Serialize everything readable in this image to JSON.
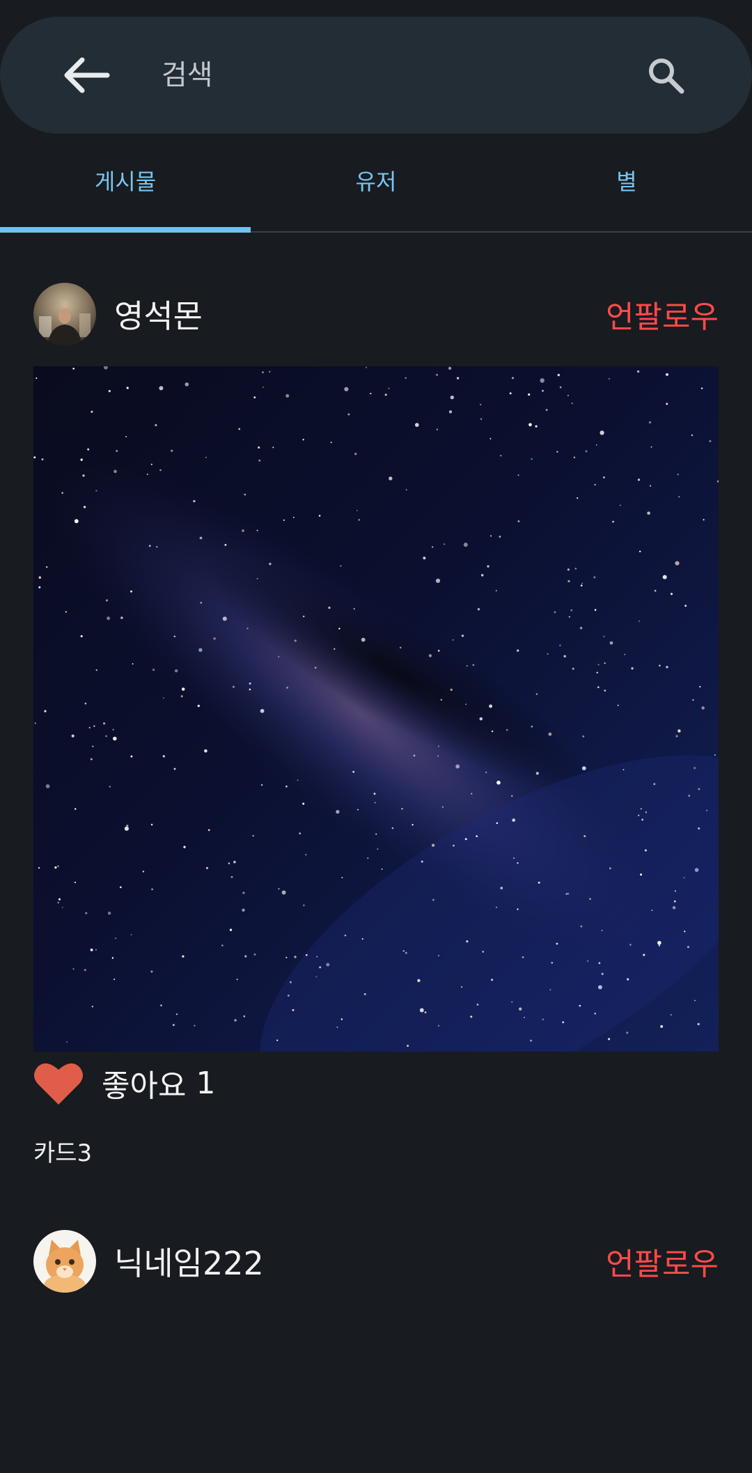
{
  "search": {
    "placeholder": "검색",
    "back_icon": "arrow-left-icon",
    "search_icon": "search-icon"
  },
  "tabs": [
    {
      "label": "게시물",
      "active": true
    },
    {
      "label": "유저",
      "active": false
    },
    {
      "label": "별",
      "active": false
    }
  ],
  "posts": [
    {
      "username": "영석몬",
      "action_label": "언팔로우",
      "avatar_icon": "profile-photo",
      "image": "night-sky-milky-way",
      "like_label": "좋아요",
      "like_count": "1",
      "caption": "카드3"
    },
    {
      "username": "닉네임222",
      "action_label": "언팔로우",
      "avatar_icon": "cat-photo"
    }
  ],
  "colors": {
    "background": "#181b1f",
    "search_bar": "#232d35",
    "tab_text": "#76c6f2",
    "tab_indicator": "#6ec3f4",
    "unfollow": "#ff4a4a",
    "heart": "#e05d4a"
  }
}
